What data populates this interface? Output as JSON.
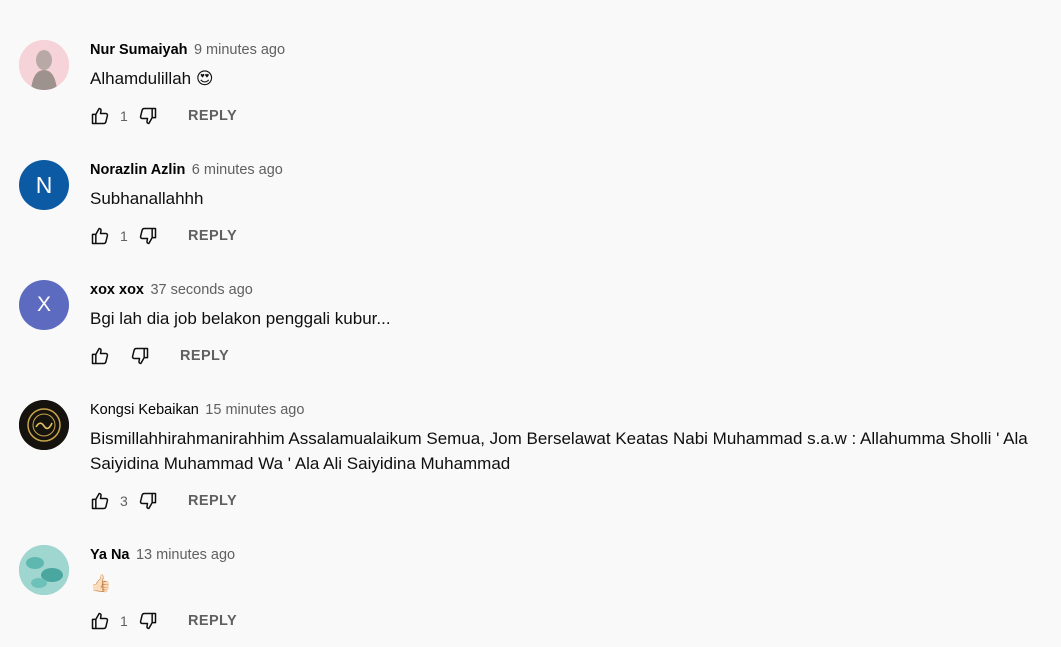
{
  "comments": [
    {
      "author": "Nur Sumaiyah",
      "time": "9 minutes ago",
      "text": "Alhamdulillah 😍",
      "likes": "1",
      "reply": "REPLY",
      "avatar_color": "#f4c8cf",
      "avatar_letter": ""
    },
    {
      "author": "Norazlin Azlin",
      "time": "6 minutes ago",
      "text": "Subhanallahhh",
      "likes": "1",
      "reply": "REPLY",
      "avatar_color": "#0b5aa3",
      "avatar_letter": "N"
    },
    {
      "author": "xox xox",
      "time": "37 seconds ago",
      "text": "Bgi lah dia job belakon penggali kubur...",
      "likes": "",
      "reply": "REPLY",
      "avatar_color": "#5c6bc0",
      "avatar_letter": "X"
    },
    {
      "author": "Kongsi Kebaikan",
      "time": "15 minutes ago",
      "text": "Bismillahhirahmanirahhim Assalamualaikum Semua, Jom Berselawat Keatas Nabi Muhammad s.a.w : Allahumma Sholli ' Ala Saiyidina Muhammad Wa ' Ala Ali Saiyidina Muhammad",
      "likes": "3",
      "reply": "REPLY",
      "avatar_color": "#1d1a14",
      "avatar_letter": ""
    },
    {
      "author": "Ya Na",
      "time": "13 minutes ago",
      "text": "👍🏻",
      "likes": "1",
      "reply": "REPLY",
      "avatar_color": "#7ec9c3",
      "avatar_letter": ""
    }
  ]
}
